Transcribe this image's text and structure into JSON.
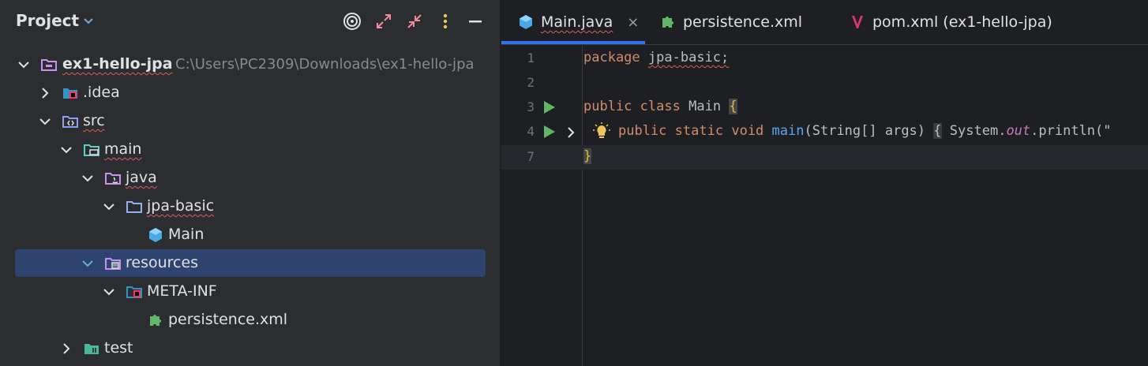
{
  "project_panel": {
    "title": "Project",
    "toolbar": {
      "locate": "target-icon",
      "expand": "expand-all-icon",
      "collapse": "collapse-all-icon",
      "options": "more-options-icon",
      "hide": "minimize-icon"
    },
    "tree": [
      {
        "label": "ex1-hello-jpa",
        "path": "C:\\Users\\PC2309\\Downloads\\ex1-hello-jpa",
        "icon": "module-folder-icon",
        "expanded": true
      },
      {
        "label": ".idea",
        "icon": "idea-folder-icon",
        "expanded": false
      },
      {
        "label": "src",
        "icon": "source-folder-icon",
        "expanded": true
      },
      {
        "label": "main",
        "icon": "main-folder-icon",
        "expanded": true
      },
      {
        "label": "java",
        "icon": "java-source-root-icon",
        "expanded": true
      },
      {
        "label": "jpa-basic",
        "icon": "package-folder-icon",
        "expanded": true
      },
      {
        "label": "Main",
        "icon": "java-class-icon"
      },
      {
        "label": "resources",
        "icon": "resources-folder-icon",
        "expanded": true,
        "selected": true
      },
      {
        "label": "META-INF",
        "icon": "meta-inf-folder-icon",
        "expanded": true
      },
      {
        "label": "persistence.xml",
        "icon": "persistence-xml-icon"
      },
      {
        "label": "test",
        "icon": "test-folder-icon",
        "expanded": false
      }
    ]
  },
  "editor": {
    "tabs": [
      {
        "label": "Main.java",
        "icon": "java-class-icon",
        "active": true,
        "close": "×"
      },
      {
        "label": "persistence.xml",
        "icon": "persistence-xml-icon"
      },
      {
        "label": "pom.xml (ex1-hello-jpa)",
        "icon": "maven-icon"
      }
    ],
    "lines": [
      {
        "num": "1",
        "tokens": [
          "package",
          "jpa-basic",
          ";"
        ]
      },
      {
        "num": "2",
        "tokens": []
      },
      {
        "num": "3",
        "tokens": [
          "public",
          "class",
          "Main",
          "{"
        ]
      },
      {
        "num": "4",
        "tokens": [
          "public",
          "static",
          "void",
          "main",
          "(String[] args)",
          "{",
          "System.",
          "out",
          ".println(\""
        ]
      },
      {
        "num": "7",
        "tokens": [
          "}"
        ]
      }
    ]
  },
  "colors": {
    "accent": "#3574f0",
    "selection": "#2e436e",
    "keyword": "#cf8e6d",
    "function": "#56a8f5",
    "run": "#5fb865"
  }
}
